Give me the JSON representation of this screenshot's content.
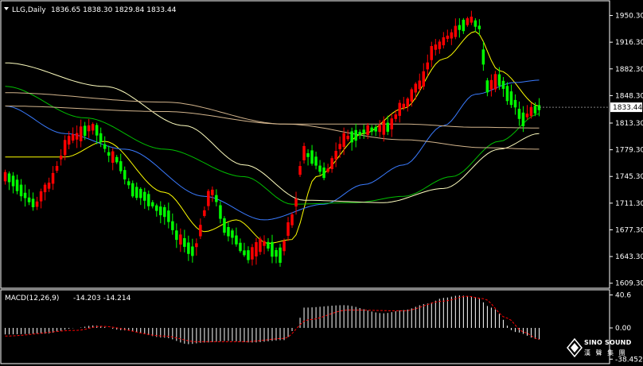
{
  "window": {
    "title": "LLG,Daily",
    "ohlc": "1836.65 1838.30 1829.84 1833.44"
  },
  "indicator": {
    "label": "MACD(12,26,9)",
    "values": "-14.203 -14.214"
  },
  "watermark": {
    "brand": "SINO SOUND",
    "sub": "漢 聲 集 團"
  },
  "colors": {
    "background": "#000000",
    "frame": "#ffffff",
    "bull": "#ff0000",
    "bear": "#00ff00",
    "ma_short": "#ffff00",
    "ma_medium": "#3a7bff",
    "ma_green": "#00c000",
    "ma_long": "#ffffc0",
    "ma_longest": "#d2b48c",
    "macd_hist": "#ffffff",
    "macd_signal": "#ff0000"
  },
  "chart_data": [
    {
      "type": "candlestick",
      "title": "LLG,Daily",
      "ylim": [
        1606,
        1966
      ],
      "ytick_labels": [
        "1950.30",
        "1916.30",
        "1882.30",
        "1848.30",
        "1813.30",
        "1779.30",
        "1745.30",
        "1711.30",
        "1677.30",
        "1643.30",
        "1609.30"
      ],
      "ytick_values": [
        1950.3,
        1916.3,
        1882.3,
        1848.3,
        1813.3,
        1779.3,
        1745.3,
        1711.3,
        1677.3,
        1643.3,
        1609.3
      ],
      "current_price": "1833.44",
      "current_value": 1833.44,
      "bars": 135,
      "anchors": [
        [
          0,
          1745
        ],
        [
          8,
          1710
        ],
        [
          10,
          1730
        ],
        [
          17,
          1795
        ],
        [
          22,
          1808
        ],
        [
          27,
          1770
        ],
        [
          33,
          1725
        ],
        [
          40,
          1700
        ],
        [
          44,
          1665
        ],
        [
          47,
          1650
        ],
        [
          52,
          1725
        ],
        [
          56,
          1675
        ],
        [
          61,
          1645
        ],
        [
          65,
          1660
        ],
        [
          69,
          1645
        ],
        [
          72,
          1690
        ],
        [
          75,
          1775
        ],
        [
          77,
          1770
        ],
        [
          80,
          1750
        ],
        [
          86,
          1795
        ],
        [
          92,
          1805
        ],
        [
          96,
          1808
        ],
        [
          100,
          1835
        ],
        [
          104,
          1862
        ],
        [
          108,
          1910
        ],
        [
          112,
          1925
        ],
        [
          114,
          1935
        ],
        [
          117,
          1945
        ],
        [
          119,
          1935
        ],
        [
          121,
          1860
        ],
        [
          124,
          1868
        ],
        [
          127,
          1845
        ],
        [
          130,
          1818
        ],
        [
          132,
          1828
        ],
        [
          134,
          1833
        ]
      ],
      "series": [
        {
          "name": "",
          "color": "#ffff00",
          "values": [
            [
              0,
              1770
            ],
            [
              15,
              1770
            ],
            [
              25,
              1790
            ],
            [
              40,
              1725
            ],
            [
              50,
              1675
            ],
            [
              58,
              1690
            ],
            [
              66,
              1660
            ],
            [
              72,
              1665
            ],
            [
              78,
              1745
            ],
            [
              90,
              1800
            ],
            [
              100,
              1832
            ],
            [
              110,
              1895
            ],
            [
              118,
              1930
            ],
            [
              124,
              1880
            ],
            [
              134,
              1835
            ]
          ]
        },
        {
          "name": "",
          "color": "#3a7bff",
          "values": [
            [
              0,
              1835
            ],
            [
              15,
              1800
            ],
            [
              30,
              1780
            ],
            [
              50,
              1720
            ],
            [
              65,
              1690
            ],
            [
              80,
              1710
            ],
            [
              90,
              1735
            ],
            [
              100,
              1760
            ],
            [
              110,
              1810
            ],
            [
              118,
              1850
            ],
            [
              128,
              1865
            ],
            [
              134,
              1868
            ]
          ]
        },
        {
          "name": "",
          "color": "#00c000",
          "values": [
            [
              0,
              1860
            ],
            [
              20,
              1820
            ],
            [
              40,
              1780
            ],
            [
              60,
              1745
            ],
            [
              72,
              1710
            ],
            [
              88,
              1712
            ],
            [
              100,
              1720
            ],
            [
              112,
              1745
            ],
            [
              124,
              1790
            ],
            [
              134,
              1825
            ]
          ]
        },
        {
          "name": "",
          "color": "#ffffc0",
          "values": [
            [
              0,
              1890
            ],
            [
              25,
              1860
            ],
            [
              45,
              1810
            ],
            [
              60,
              1760
            ],
            [
              75,
              1715
            ],
            [
              95,
              1712
            ],
            [
              110,
              1730
            ],
            [
              124,
              1780
            ],
            [
              134,
              1800
            ]
          ]
        },
        {
          "name": "",
          "color": "#d2b48c",
          "values": [
            [
              0,
              1835
            ],
            [
              40,
              1828
            ],
            [
              70,
              1812
            ],
            [
              100,
              1812
            ],
            [
              118,
              1808
            ],
            [
              134,
              1807
            ]
          ]
        },
        {
          "name": "",
          "color": "#d2b48c",
          "values": [
            [
              0,
              1852
            ],
            [
              40,
              1840
            ],
            [
              70,
              1812
            ],
            [
              100,
              1792
            ],
            [
              120,
              1782
            ],
            [
              134,
              1780
            ]
          ]
        }
      ]
    },
    {
      "type": "macd",
      "title": "MACD(12,26,9)",
      "ylim": [
        -42,
        44
      ],
      "ytick_labels": [
        "40.6",
        "0.00",
        "-38.452"
      ],
      "ytick_values": [
        40.6,
        0.0,
        -38.452
      ],
      "anchors": [
        [
          0,
          -8
        ],
        [
          10,
          -7
        ],
        [
          18,
          0
        ],
        [
          22,
          3
        ],
        [
          30,
          -3
        ],
        [
          40,
          -12
        ],
        [
          46,
          -20
        ],
        [
          50,
          -18
        ],
        [
          56,
          -16
        ],
        [
          62,
          -18
        ],
        [
          70,
          -15
        ],
        [
          73,
          0
        ],
        [
          75,
          25
        ],
        [
          85,
          28
        ],
        [
          95,
          18
        ],
        [
          100,
          22
        ],
        [
          106,
          30
        ],
        [
          110,
          37
        ],
        [
          114,
          40
        ],
        [
          118,
          38
        ],
        [
          122,
          25
        ],
        [
          128,
          -5
        ],
        [
          134,
          -14.2
        ]
      ],
      "signal": [
        [
          0,
          -10
        ],
        [
          18,
          -3
        ],
        [
          24,
          2
        ],
        [
          40,
          -10
        ],
        [
          48,
          -17
        ],
        [
          60,
          -17
        ],
        [
          70,
          -13
        ],
        [
          76,
          10
        ],
        [
          86,
          22
        ],
        [
          100,
          21
        ],
        [
          110,
          33
        ],
        [
          116,
          39
        ],
        [
          120,
          36
        ],
        [
          126,
          12
        ],
        [
          130,
          -5
        ],
        [
          134,
          -14.2
        ]
      ]
    }
  ]
}
